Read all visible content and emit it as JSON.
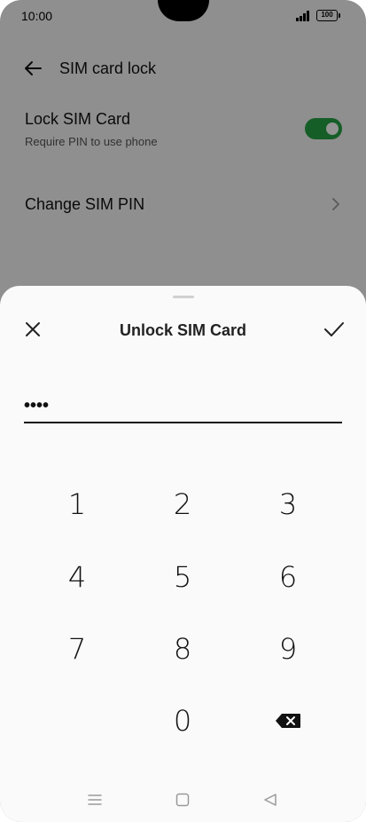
{
  "status_bar": {
    "time": "10:00",
    "battery": "100"
  },
  "app_bar": {
    "title": "SIM card lock"
  },
  "settings": {
    "lock_sim": {
      "title": "Lock SIM Card",
      "subtitle": "Require PIN to use phone",
      "enabled": true
    },
    "change_pin": {
      "title": "Change SIM PIN"
    }
  },
  "sheet": {
    "title": "Unlock SIM Card",
    "pin_value": "••••"
  },
  "keypad": {
    "keys": [
      "1",
      "2",
      "3",
      "4",
      "5",
      "6",
      "7",
      "8",
      "9",
      "0"
    ]
  },
  "icons": {
    "back": "arrow-left-icon",
    "close": "close-icon",
    "confirm": "check-icon",
    "delete": "backspace-icon",
    "nav_menu": "menu-icon",
    "nav_home": "home-icon",
    "nav_back": "triangle-back-icon"
  },
  "colors": {
    "toggle_on": "#27a245",
    "scrim": "rgba(0,0,0,0.42)"
  }
}
